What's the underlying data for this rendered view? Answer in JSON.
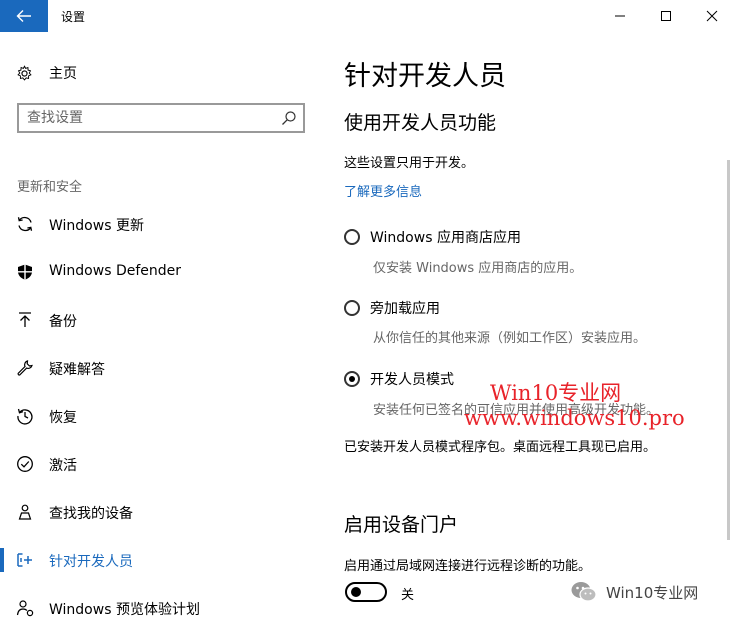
{
  "titlebar": {
    "title": "设置"
  },
  "sidebar": {
    "home_label": "主页",
    "search_placeholder": "查找设置",
    "section_header": "更新和安全",
    "items": [
      {
        "label": "Windows 更新",
        "icon": "refresh-icon"
      },
      {
        "label": "Windows Defender",
        "icon": "shield-icon"
      },
      {
        "label": "备份",
        "icon": "backup-arrow-icon"
      },
      {
        "label": "疑难解答",
        "icon": "wrench-icon"
      },
      {
        "label": "恢复",
        "icon": "history-icon"
      },
      {
        "label": "激活",
        "icon": "check-circle-icon"
      },
      {
        "label": "查找我的设备",
        "icon": "person-pin-icon"
      },
      {
        "label": "针对开发人员",
        "icon": "developer-tools-icon",
        "active": true
      },
      {
        "label": "Windows 预览体验计划",
        "icon": "insider-person-icon"
      }
    ]
  },
  "main": {
    "page_title": "针对开发人员",
    "section1_title": "使用开发人员功能",
    "section1_intro": "这些设置只用于开发。",
    "learn_more": "了解更多信息",
    "options": [
      {
        "label": "Windows 应用商店应用",
        "desc": "仅安装 Windows 应用商店的应用。",
        "checked": false
      },
      {
        "label": "旁加载应用",
        "desc": "从你信任的其他来源（例如工作区）安装应用。",
        "checked": false
      },
      {
        "label": "开发人员模式",
        "desc": "安装任何已签名的可信应用并使用高级开发功能。",
        "checked": true
      }
    ],
    "status_text": "已安装开发人员模式程序包。桌面远程工具现已启用。",
    "section2_title": "启用设备门户",
    "section2_desc": "启用通过局域网连接进行远程诊断的功能。",
    "toggle_state": "关"
  },
  "watermark": {
    "line1": "Win10专业网",
    "line2": "www.windows10.pro",
    "wechat_label": "Win10专业网"
  },
  "colors": {
    "accent": "#1a69bd",
    "watermark": "#e8232a"
  }
}
